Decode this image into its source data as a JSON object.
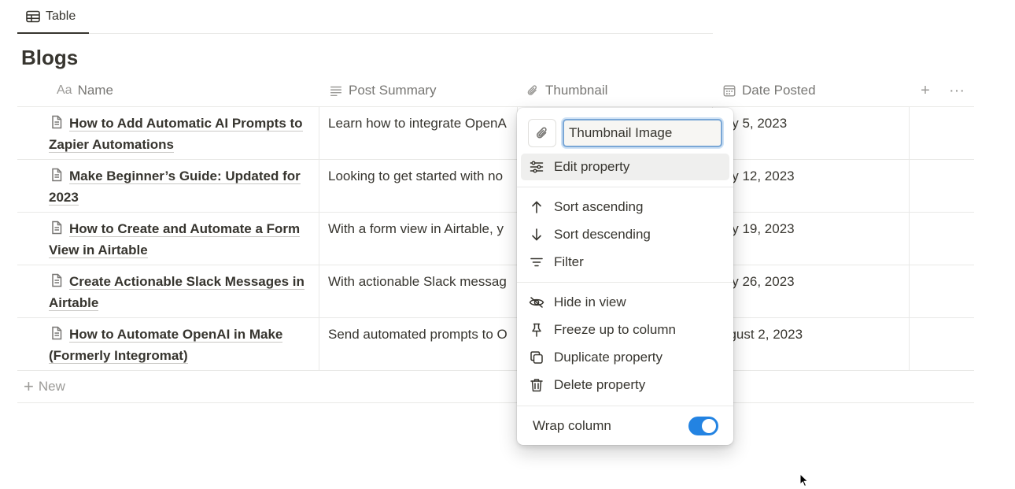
{
  "view_tab": {
    "label": "Table",
    "icon": "table-icon"
  },
  "database": {
    "title": "Blogs"
  },
  "columns": [
    {
      "label": "Name",
      "icon": "text-aa-icon"
    },
    {
      "label": "Post Summary",
      "icon": "lines-icon"
    },
    {
      "label": "Thumbnail",
      "icon": "paperclip-icon"
    },
    {
      "label": "Date Posted",
      "icon": "calendar-icon"
    }
  ],
  "header_actions": {
    "add": "+",
    "more": "···"
  },
  "rows": [
    {
      "name": "How to Add Automatic AI Prompts to Zapier Automations",
      "summary": "Learn how to integrate OpenA",
      "date": "uly 5, 2023"
    },
    {
      "name": "Make Beginner’s Guide: Updated for 2023",
      "summary": "Looking to get started with no",
      "date": "uly 12, 2023"
    },
    {
      "name": "How to Create and Automate a Form View in Airtable",
      "summary": "With a form view in Airtable, y",
      "date": "uly 19, 2023"
    },
    {
      "name": "Create Actionable Slack Messages in Airtable",
      "summary": "With actionable Slack messag",
      "date": "uly 26, 2023"
    },
    {
      "name": "How to Automate OpenAI in Make (Formerly Integromat)",
      "summary": "Send automated prompts to O",
      "date": "ugust 2, 2023"
    }
  ],
  "new_row": {
    "plus": "+",
    "label": "New"
  },
  "menu": {
    "property_name": "Thumbnail Image",
    "items": [
      {
        "label": "Edit property",
        "icon": "sliders-icon"
      },
      {
        "label": "Sort ascending",
        "icon": "arrow-up-icon"
      },
      {
        "label": "Sort descending",
        "icon": "arrow-down-icon"
      },
      {
        "label": "Filter",
        "icon": "filter-icon"
      },
      {
        "label": "Hide in view",
        "icon": "eye-slash-icon"
      },
      {
        "label": "Freeze up to column",
        "icon": "pin-icon"
      },
      {
        "label": "Duplicate property",
        "icon": "duplicate-icon"
      },
      {
        "label": "Delete property",
        "icon": "trash-icon"
      }
    ],
    "wrap_label": "Wrap column",
    "wrap_on": true
  },
  "colors": {
    "text": "#37352f",
    "muted": "#787774",
    "border": "#e9e9e7",
    "toggle_on": "#2383e2"
  }
}
